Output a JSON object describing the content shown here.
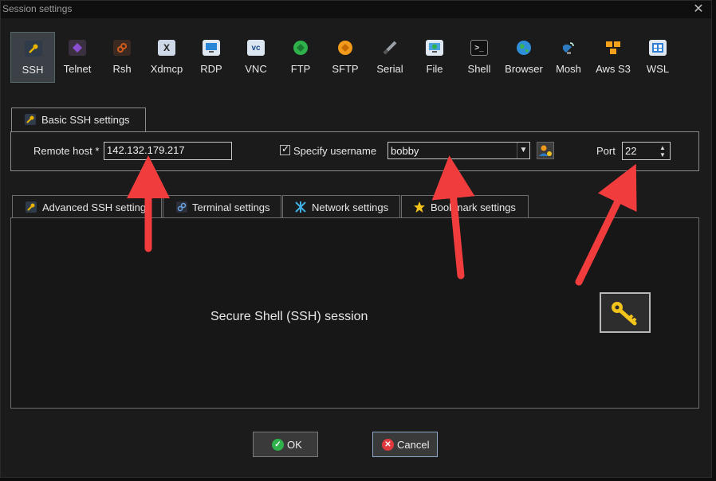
{
  "window": {
    "title": "Session settings"
  },
  "session_types": [
    {
      "label": "SSH",
      "icon": "wrench-icon",
      "selected": true,
      "color": "#e8b400"
    },
    {
      "label": "Telnet",
      "icon": "telnet-icon",
      "color": "#8a4fd1"
    },
    {
      "label": "Rsh",
      "icon": "rsh-icon",
      "color": "#d05a1e"
    },
    {
      "label": "Xdmcp",
      "icon": "xdmcp-icon",
      "color": "#cfd8e6"
    },
    {
      "label": "RDP",
      "icon": "rdp-icon",
      "color": "#2a86d6"
    },
    {
      "label": "VNC",
      "icon": "vnc-icon",
      "color": "#dbe6f0"
    },
    {
      "label": "FTP",
      "icon": "ftp-icon",
      "color": "#2fb14b"
    },
    {
      "label": "SFTP",
      "icon": "sftp-icon",
      "color": "#f29a1a"
    },
    {
      "label": "Serial",
      "icon": "serial-icon",
      "color": "#9aa0a6"
    },
    {
      "label": "File",
      "icon": "file-icon",
      "color": "#4aa3df"
    },
    {
      "label": "Shell",
      "icon": "shell-icon",
      "color": "#2b2b2b"
    },
    {
      "label": "Browser",
      "icon": "browser-icon",
      "color": "#2e8fd8"
    },
    {
      "label": "Mosh",
      "icon": "mosh-icon",
      "color": "#2d7cc2"
    },
    {
      "label": "Aws S3",
      "icon": "aws-icon",
      "color": "#f4a21b"
    },
    {
      "label": "WSL",
      "icon": "wsl-icon",
      "color": "#2f7fd4"
    }
  ],
  "basic": {
    "tab_label": "Basic SSH settings",
    "remote_host_label": "Remote host *",
    "remote_host_value": "142.132.179.217",
    "specify_username_label": "Specify username",
    "specify_username_checked": true,
    "username_value": "bobby",
    "port_label": "Port",
    "port_value": "22"
  },
  "tabs": [
    {
      "label": "Advanced SSH settings",
      "icon": "wrench-icon"
    },
    {
      "label": "Terminal settings",
      "icon": "terminal-icon"
    },
    {
      "label": "Network settings",
      "icon": "network-icon"
    },
    {
      "label": "Bookmark settings",
      "icon": "star-icon"
    }
  ],
  "panel": {
    "description": "Secure Shell (SSH) session"
  },
  "buttons": {
    "ok": "OK",
    "cancel": "Cancel"
  },
  "colors": {
    "accent_arrow": "#f03c3c",
    "ok_green": "#2fb14b",
    "cancel_red": "#e0393e"
  }
}
